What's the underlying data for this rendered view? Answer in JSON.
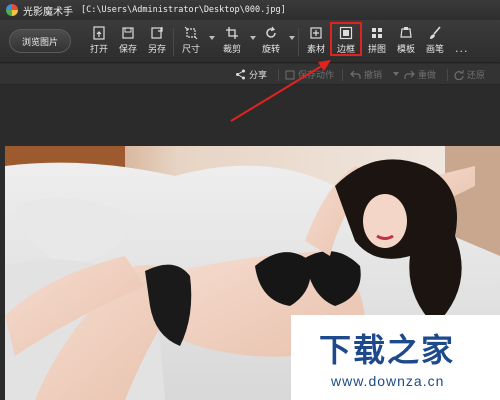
{
  "window": {
    "app_title": "光影魔术手",
    "file_path": "[C:\\Users\\Administrator\\Desktop\\000.jpg]"
  },
  "toolbar": {
    "browse_label": "浏览图片",
    "open_label": "打开",
    "save_label": "保存",
    "save_as_label": "另存",
    "size_label": "尺寸",
    "crop_label": "裁剪",
    "rotate_label": "旋转",
    "material_label": "素材",
    "border_label": "边框",
    "collage_label": "拼图",
    "template_label": "模板",
    "brush_label": "画笔",
    "more_label": "···"
  },
  "subbar": {
    "share_label": "分享",
    "save_action_label": "保存动作",
    "undo_label": "撤销",
    "redo_label": "重做",
    "restore_label": "还原"
  },
  "colors": {
    "highlight": "#e0231e",
    "toolbar_bg": "#333333",
    "watermark_text": "#1e4a8c"
  },
  "watermark": {
    "title": "下载之家",
    "url": "www.downza.cn"
  }
}
